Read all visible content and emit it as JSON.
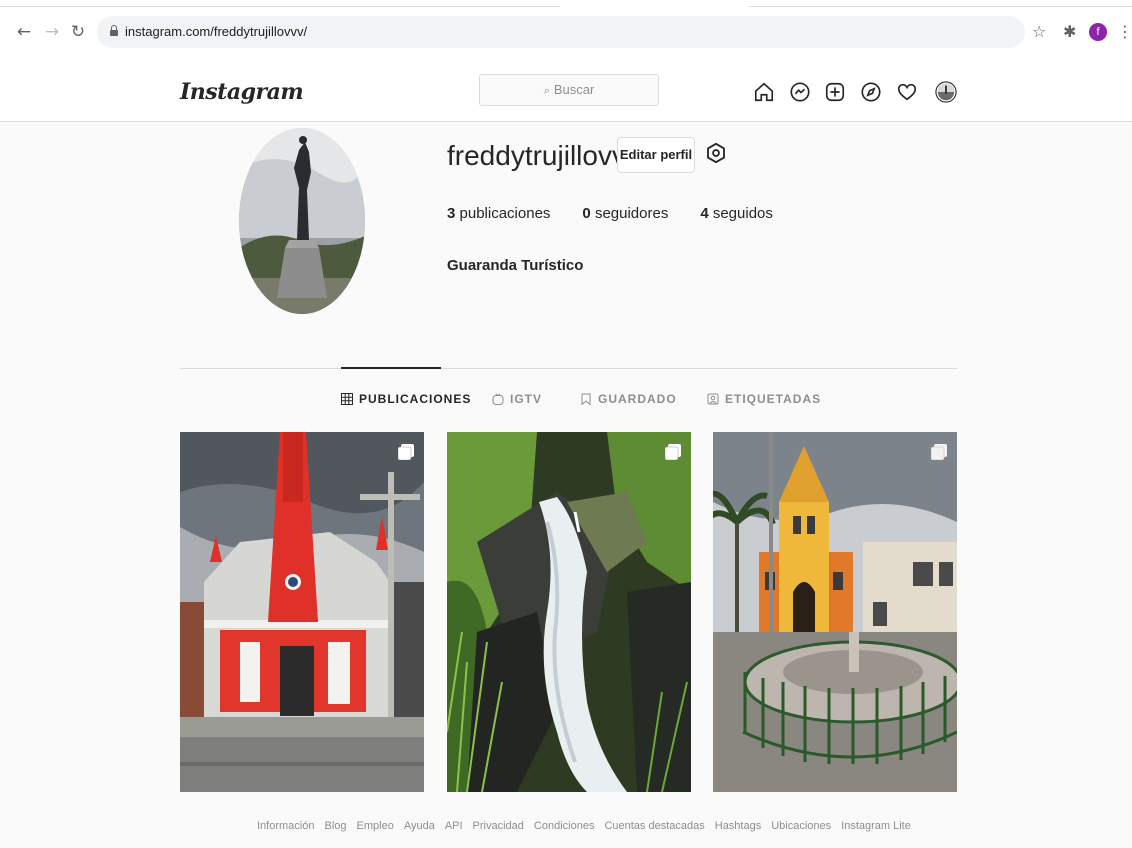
{
  "browser": {
    "url": "instagram.com/freddytrujillovvv/",
    "profile_initial": "f"
  },
  "header": {
    "logo": "Instagram",
    "search_placeholder": "Buscar"
  },
  "profile": {
    "username": "freddytrujillovvv",
    "edit_label": "Editar perfil",
    "posts_count": "3",
    "posts_label": "publicaciones",
    "followers_count": "0",
    "followers_label": "seguidores",
    "following_count": "4",
    "following_label": "seguidos",
    "bio_name": "Guaranda Turístico"
  },
  "tabs": [
    {
      "label": "PUBLICACIONES",
      "active": true
    },
    {
      "label": "IGTV",
      "active": false
    },
    {
      "label": "GUARDADO",
      "active": false
    },
    {
      "label": "ETIQUETADAS",
      "active": false
    }
  ],
  "footer": {
    "links": [
      "Información",
      "Blog",
      "Empleo",
      "Ayuda",
      "API",
      "Privacidad",
      "Condiciones",
      "Cuentas destacadas",
      "Hashtags",
      "Ubicaciones",
      "Instagram Lite"
    ]
  },
  "colors": {
    "church_red": "#e0302a",
    "accent_purple": "#8e24aa"
  }
}
